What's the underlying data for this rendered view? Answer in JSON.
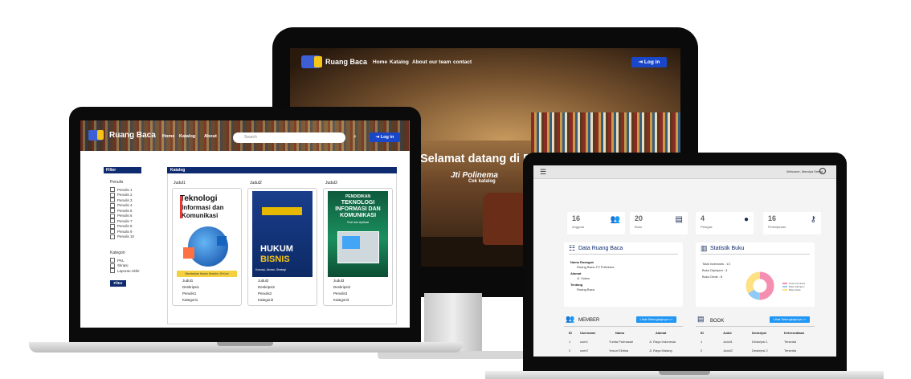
{
  "monitor": {
    "brand": "Ruang Baca",
    "nav": [
      "Home",
      "Katalog",
      "About",
      "our team",
      "contact"
    ],
    "login": "Log in",
    "hero_title": "Selamat datang di Ruang Baca",
    "hero_sub": "Jti Polinema",
    "cta": "Cek katalog"
  },
  "catalog_app": {
    "brand": "Ruang Baca",
    "nav": [
      "Home",
      "Katalog",
      "About"
    ],
    "search_placeholder": "Search",
    "login": "Log in",
    "filter": {
      "header": "Filter",
      "penulis_title": "Penulis",
      "penulis": [
        "Penulis 1",
        "Penulis 2",
        "Penulis 3",
        "Penulis 4",
        "Penulis 5",
        "Penulis 6",
        "Penulis 7",
        "Penulis 8",
        "Penulis 9",
        "Penulis 10"
      ],
      "kategori_title": "Kategori",
      "kategori": [
        "PKL",
        "Skripsi",
        "Laporan Akhir"
      ],
      "button": "Filter"
    },
    "katalog": {
      "header": "Katalog",
      "books": [
        {
          "heading": "Judul1",
          "cover_title_1": "Teknologi",
          "cover_title_2": "Informasi dan",
          "cover_title_3": "Komunikasi",
          "cover_author": "Membahas Hasrin Ibrahim, M.Kom",
          "lines": [
            "Judul1",
            "Deskripsi1",
            "Penulis1",
            "Kategori1"
          ]
        },
        {
          "heading": "Judul2",
          "cover_title_1": "HUKUM",
          "cover_title_2": "BISNIS",
          "cover_author": "Konsep, Aturan, Strategi",
          "lines": [
            "Judul2",
            "Deskripsi2",
            "Penulis2",
            "Kategori2"
          ]
        },
        {
          "heading": "Judul3",
          "cover_title_1": "PENDIDIKAN",
          "cover_title_2": "TEKNOLOGI",
          "cover_title_3": "INFORMASI DAN",
          "cover_title_4": "KOMUNIKASI",
          "cover_author": "Teori dan Aplikasi",
          "lines": [
            "Judul3",
            "Deskripsi3",
            "Penulis3",
            "Kategori3"
          ]
        }
      ]
    }
  },
  "admin_app": {
    "welcome": "Welcome, Mandya Setiya",
    "stats": [
      {
        "num": "16",
        "label": "Anggota",
        "icon": "users-icon"
      },
      {
        "num": "20",
        "label": "Buku",
        "icon": "book-icon"
      },
      {
        "num": "4",
        "label": "Petugas",
        "icon": "person-icon"
      },
      {
        "num": "16",
        "label": "Peminjaman",
        "icon": "person-key-icon"
      }
    ],
    "data_panel": {
      "title": "Data Ruang Baca",
      "nama_label": "Nama Ruangan",
      "nama_value": "Ruang Baca JTI Polinema",
      "alamat_label": "Alamat",
      "alamat_value": "Jl. Sukso",
      "tentang_label": "Tentang",
      "tentang_value": "Ruang Baca"
    },
    "stat_panel": {
      "title": "Statistik Buku",
      "total_label": "Total Inventaris",
      "total_value": "13",
      "dipinjam_label": "Buku Dipinjam",
      "dipinjam_value": "4",
      "dirak_label": "Buku Dirak",
      "dirak_value": "8",
      "legend": [
        "Total Inventaris",
        "Buku Dipinjam",
        "Buku Dirak"
      ],
      "colors": [
        "#f48fb1",
        "#90caf9",
        "#ffe082"
      ]
    },
    "member": {
      "title": "MEMBER",
      "button": "Lihat Selengkapnya >>",
      "columns": [
        "ID",
        "Username",
        "Nama",
        "Alamat"
      ],
      "rows": [
        [
          "1",
          "user1",
          "Yunita Putmasari",
          "Jl. Raya Indonesia"
        ],
        [
          "2",
          "user2",
          "Yosun Ekhisa",
          "Jl. Raya Malang"
        ]
      ]
    },
    "book": {
      "title": "BOOK",
      "button": "Lihat Selengkapnya >>",
      "columns": [
        "ID",
        "Judul",
        "Deskripsi",
        "Ketersediaan"
      ],
      "rows": [
        [
          "1",
          "Judul1",
          "Deskripsi 1",
          "Tersedia"
        ],
        [
          "2",
          "Judul2",
          "Deskripsi 2",
          "Tersedia"
        ]
      ]
    }
  }
}
